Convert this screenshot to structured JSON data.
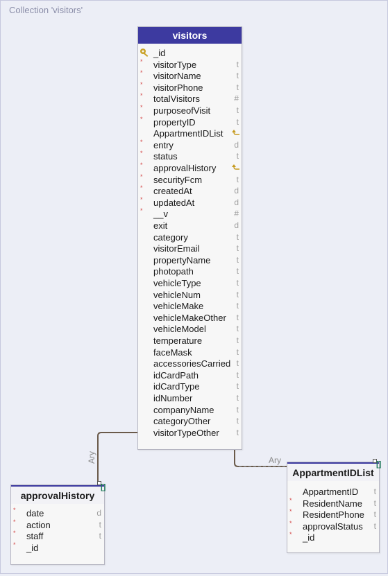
{
  "collection_title": "Collection 'visitors'",
  "visitors": {
    "title": "visitors",
    "fields": [
      {
        "name": "_id",
        "type": "",
        "req": false,
        "key": true
      },
      {
        "name": "visitorType",
        "type": "t",
        "req": true
      },
      {
        "name": "visitorName",
        "type": "t",
        "req": true
      },
      {
        "name": "visitorPhone",
        "type": "t",
        "req": true
      },
      {
        "name": "totalVisitors",
        "type": "#",
        "req": true
      },
      {
        "name": "purposeofVisit",
        "type": "t",
        "req": true
      },
      {
        "name": "propertyID",
        "type": "t",
        "req": true
      },
      {
        "name": "AppartmentIDList",
        "type": "",
        "req": false,
        "link": true
      },
      {
        "name": "entry",
        "type": "d",
        "req": true
      },
      {
        "name": "status",
        "type": "t",
        "req": true
      },
      {
        "name": "approvalHistory",
        "type": "",
        "req": true,
        "link": true
      },
      {
        "name": "securityFcm",
        "type": "t",
        "req": true
      },
      {
        "name": "createdAt",
        "type": "d",
        "req": true
      },
      {
        "name": "updatedAt",
        "type": "d",
        "req": true
      },
      {
        "name": "__v",
        "type": "#",
        "req": true
      },
      {
        "name": "exit",
        "type": "d",
        "req": false
      },
      {
        "name": "category",
        "type": "t",
        "req": false
      },
      {
        "name": "visitorEmail",
        "type": "t",
        "req": false
      },
      {
        "name": "propertyName",
        "type": "t",
        "req": false
      },
      {
        "name": "photopath",
        "type": "t",
        "req": false
      },
      {
        "name": "vehicleType",
        "type": "t",
        "req": false
      },
      {
        "name": "vehicleNum",
        "type": "t",
        "req": false
      },
      {
        "name": "vehicleMake",
        "type": "t",
        "req": false
      },
      {
        "name": "vehicleMakeOther",
        "type": "t",
        "req": false
      },
      {
        "name": "vehicleModel",
        "type": "t",
        "req": false
      },
      {
        "name": "temperature",
        "type": "t",
        "req": false
      },
      {
        "name": "faceMask",
        "type": "t",
        "req": false
      },
      {
        "name": "accessoriesCarried",
        "type": "t",
        "req": false
      },
      {
        "name": "idCardPath",
        "type": "t",
        "req": false
      },
      {
        "name": "idCardType",
        "type": "t",
        "req": false
      },
      {
        "name": "idNumber",
        "type": "t",
        "req": false
      },
      {
        "name": "companyName",
        "type": "t",
        "req": false
      },
      {
        "name": "categoryOther",
        "type": "t",
        "req": false
      },
      {
        "name": "visitorTypeOther",
        "type": "t",
        "req": false
      }
    ]
  },
  "approvalHistory": {
    "title": "approvalHistory",
    "badge": "[]",
    "fields": [
      {
        "name": "date",
        "type": "d",
        "req": true
      },
      {
        "name": "action",
        "type": "t",
        "req": true
      },
      {
        "name": "staff",
        "type": "t",
        "req": true
      },
      {
        "name": "_id",
        "type": "",
        "req": true
      }
    ]
  },
  "appartmentIDList": {
    "title": "AppartmentIDList",
    "badge": "[]",
    "fields": [
      {
        "name": "AppartmentID",
        "type": "t",
        "req": false
      },
      {
        "name": "ResidentName",
        "type": "t",
        "req": true
      },
      {
        "name": "ResidentPhone",
        "type": "t",
        "req": true
      },
      {
        "name": "approvalStatus",
        "type": "t",
        "req": true
      },
      {
        "name": "_id",
        "type": "",
        "req": true
      }
    ]
  },
  "relations": {
    "left_label": "Ary",
    "right_label": "Ary"
  },
  "colors": {
    "header_bg": "#3d3aa0",
    "required_mark": "#d44a4a",
    "link_arrow": "#c59a1e",
    "key_icon": "#c9a227",
    "badge": "#1e7a5a"
  }
}
